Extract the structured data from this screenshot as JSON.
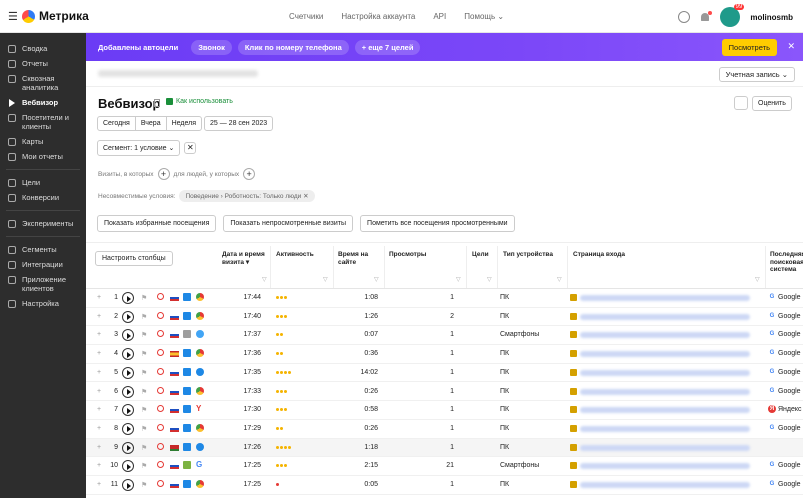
{
  "header": {
    "app_title": "Метрика",
    "nav": [
      "Счетчики",
      "Настройка аккаунта",
      "API",
      "Помощь"
    ],
    "notification_badge": "99",
    "username": "molinosmb"
  },
  "sidebar": {
    "items": [
      {
        "label": "Сводка"
      },
      {
        "label": "Отчеты"
      },
      {
        "label": "Сквозная аналитика"
      },
      {
        "label": "Вебвизор",
        "active": true
      },
      {
        "label": "Посетители и клиенты"
      },
      {
        "label": "Карты"
      },
      {
        "label": "Мои отчеты"
      },
      {
        "label": "Цели"
      },
      {
        "label": "Конверсии"
      },
      {
        "label": "Эксперименты"
      },
      {
        "label": "Сегменты"
      },
      {
        "label": "Интеграции"
      },
      {
        "label": "Приложение клиентов"
      },
      {
        "label": "Настройка"
      }
    ]
  },
  "promo": {
    "chips": [
      "Добавлены автоцели",
      "Звонок",
      "Клик по номеру телефона",
      "+ еще 7 целей"
    ],
    "button": "Посмотреть",
    "close": "✕"
  },
  "counter": {
    "account_select": "Учетная запись ⌄"
  },
  "page": {
    "title": "Вебвизор",
    "howto": "Как использовать",
    "rate": "Оценить",
    "date_buttons": [
      "Сегодня",
      "Вчера",
      "Неделя"
    ],
    "date_range": "25 — 28 сен 2023",
    "segment": "Сегмент: 1 условие ⌄",
    "visits_prefix": "Визиты, в которых",
    "people_prefix": "для людей, у которых",
    "incompat_label": "Несовместимые условия:",
    "incompat_chip": "Поведение › Роботность: Только люди ✕",
    "actions": [
      "Показать избранные посещения",
      "Показать непросмотренные визиты",
      "Пометить все посещения просмотренными"
    ]
  },
  "table": {
    "configure": "Настроить столбцы",
    "headers": {
      "datetime": "Дата и время визита",
      "activity": "Активность",
      "duration": "Время на сайте",
      "views": "Просмотры",
      "goals": "Цели",
      "device": "Тип устройства",
      "entry": "Страница входа",
      "search": "Последняя поисковая система"
    },
    "rows": [
      {
        "n": "1",
        "time": "17:44",
        "act": 3,
        "dur": "1:08",
        "views": "1",
        "goals": "",
        "dev": "ПК",
        "os": "win",
        "br": "chrome",
        "country": "ru",
        "se": "Google"
      },
      {
        "n": "2",
        "time": "17:40",
        "act": 3,
        "dur": "1:26",
        "views": "2",
        "goals": "",
        "dev": "ПК",
        "os": "win",
        "br": "chrome",
        "country": "ru",
        "se": "Google"
      },
      {
        "n": "3",
        "time": "17:37",
        "act": 2,
        "dur": "0:07",
        "views": "1",
        "goals": "",
        "dev": "Смартфоны",
        "os": "apple",
        "br": "safari",
        "country": "ru",
        "se": "Google"
      },
      {
        "n": "4",
        "time": "17:36",
        "act": 2,
        "dur": "0:36",
        "views": "1",
        "goals": "",
        "dev": "ПК",
        "os": "win",
        "br": "chrome",
        "country": "es",
        "se": "Google"
      },
      {
        "n": "5",
        "time": "17:35",
        "act": 4,
        "dur": "14:02",
        "views": "1",
        "goals": "",
        "dev": "ПК",
        "os": "win",
        "br": "edge",
        "country": "ru",
        "se": "Google"
      },
      {
        "n": "6",
        "time": "17:33",
        "act": 3,
        "dur": "0:26",
        "views": "1",
        "goals": "",
        "dev": "ПК",
        "os": "win",
        "br": "chrome",
        "country": "ru",
        "se": "Google"
      },
      {
        "n": "7",
        "time": "17:30",
        "act": 3,
        "dur": "0:58",
        "views": "1",
        "goals": "",
        "dev": "ПК",
        "os": "win",
        "br": "yandex",
        "country": "ru",
        "se": "Яндекс"
      },
      {
        "n": "8",
        "time": "17:29",
        "act": 2,
        "dur": "0:26",
        "views": "1",
        "goals": "",
        "dev": "ПК",
        "os": "win",
        "br": "chrome",
        "country": "ru",
        "se": "Google"
      },
      {
        "n": "9",
        "time": "17:26",
        "act": 4,
        "dur": "1:18",
        "views": "1",
        "goals": "",
        "dev": "ПК",
        "os": "win",
        "br": "edge",
        "country": "by",
        "se": ""
      },
      {
        "n": "10",
        "time": "17:25",
        "act": 3,
        "dur": "2:15",
        "views": "21",
        "goals": "",
        "dev": "Смартфоны",
        "os": "android",
        "br": "google",
        "country": "ru",
        "se": "Google"
      },
      {
        "n": "11",
        "time": "17:25",
        "act": 1,
        "dur": "0:05",
        "views": "1",
        "goals": "",
        "dev": "ПК",
        "os": "win",
        "br": "chrome",
        "country": "ru",
        "se": "Google"
      }
    ]
  }
}
